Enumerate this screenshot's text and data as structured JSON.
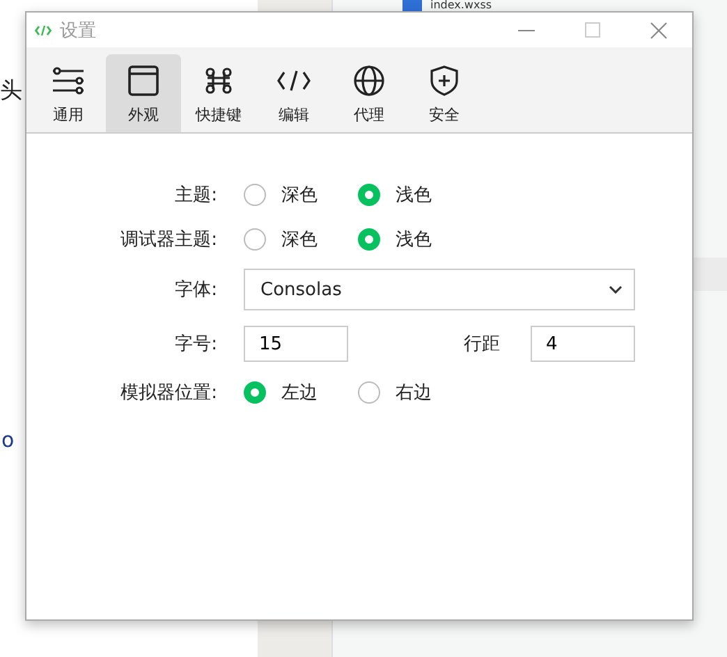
{
  "background": {
    "file_tab": "index.wxss",
    "text_1": "头",
    "text_2": "o"
  },
  "window": {
    "title": "设置"
  },
  "tabs": [
    {
      "label": "通用",
      "selected": false
    },
    {
      "label": "外观",
      "selected": true
    },
    {
      "label": "快捷键",
      "selected": false
    },
    {
      "label": "编辑",
      "selected": false
    },
    {
      "label": "代理",
      "selected": false
    },
    {
      "label": "安全",
      "selected": false
    }
  ],
  "rows": [
    {
      "kind": "radio",
      "label": "主题:",
      "options": [
        {
          "label": "深色",
          "selected": false
        },
        {
          "label": "浅色",
          "selected": true
        }
      ]
    },
    {
      "kind": "radio",
      "label": "调试器主题:",
      "options": [
        {
          "label": "深色",
          "selected": false
        },
        {
          "label": "浅色",
          "selected": true
        }
      ]
    },
    {
      "kind": "select",
      "label": "字体:",
      "value": "Consolas"
    },
    {
      "kind": "numbers",
      "label": "字号:",
      "value": "15",
      "label_2": "行距",
      "value_2": "4"
    },
    {
      "kind": "radio",
      "label": "模拟器位置:",
      "options": [
        {
          "label": "左边",
          "selected": true
        },
        {
          "label": "右边",
          "selected": false
        }
      ]
    }
  ]
}
